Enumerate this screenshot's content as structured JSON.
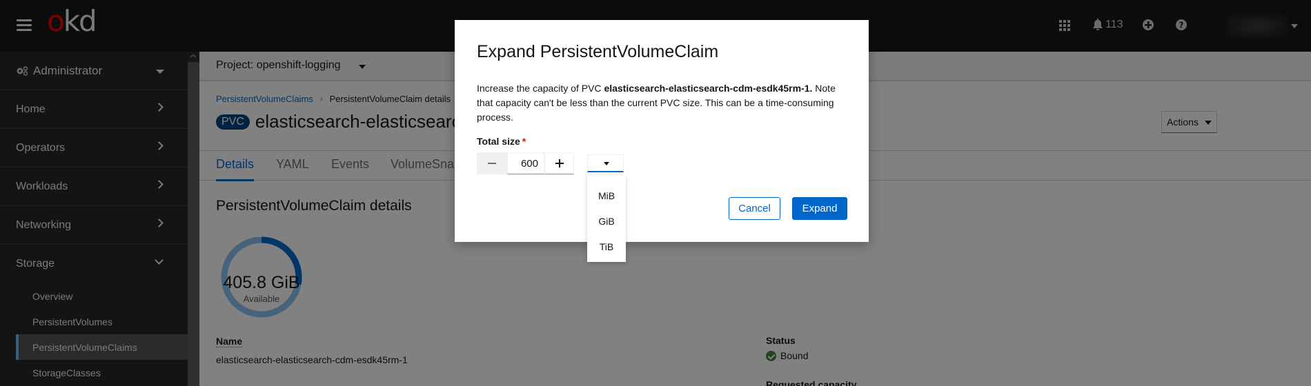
{
  "masthead": {
    "logo_o": "o",
    "logo_rest": "kd",
    "notifications_count": "113",
    "user_name_redacted": true
  },
  "sidebar": {
    "perspective": "Administrator",
    "items": [
      {
        "label": "Home",
        "expanded": false
      },
      {
        "label": "Operators",
        "expanded": false
      },
      {
        "label": "Workloads",
        "expanded": false
      },
      {
        "label": "Networking",
        "expanded": false
      },
      {
        "label": "Storage",
        "expanded": true
      }
    ],
    "storage_subitems": [
      {
        "label": "Overview",
        "active": false
      },
      {
        "label": "PersistentVolumes",
        "active": false
      },
      {
        "label": "PersistentVolumeClaims",
        "active": true
      },
      {
        "label": "StorageClasses",
        "active": false
      }
    ]
  },
  "main": {
    "project_selector": "Project: openshift-logging",
    "breadcrumb": {
      "parent": "PersistentVolumeClaims",
      "current": "PersistentVolumeClaim details"
    },
    "badge": "PVC",
    "title": "elasticsearch-elasticsearch-cdm-esdk45rm-1",
    "actions_label": "Actions",
    "tabs": [
      {
        "label": "Details",
        "active": true
      },
      {
        "label": "YAML",
        "active": false
      },
      {
        "label": "Events",
        "active": false
      },
      {
        "label": "VolumeSnapshots",
        "active": false
      }
    ],
    "section_title": "PersistentVolumeClaim details",
    "usage": {
      "available_value": "405.8 GiB",
      "available_label": "Available",
      "used_fraction": 0.28
    },
    "details": {
      "name_label": "Name",
      "name_value": "elasticsearch-elasticsearch-cdm-esdk45rm-1",
      "status_label": "Status",
      "status_value": "Bound",
      "requested_capacity_label": "Requested capacity"
    }
  },
  "modal": {
    "title": "Expand PersistentVolumeClaim",
    "desc_prefix": "Increase the capacity of PVC ",
    "desc_pvc": "elasticsearch-elasticsearch-cdm-esdk45rm-1.",
    "desc_suffix": " Note that capacity can't be less than the current PVC size. This can be a time-consuming process.",
    "field_label": "Total size",
    "required_mark": "*",
    "size_value": "600",
    "unit_selected": "",
    "unit_options": [
      "MiB",
      "GiB",
      "TiB"
    ],
    "cancel_label": "Cancel",
    "submit_label": "Expand"
  },
  "colors": {
    "primary": "#0066cc",
    "badge": "#004080",
    "success": "#3e8635",
    "required": "#c9190b",
    "logo_accent": "#ee0000"
  }
}
